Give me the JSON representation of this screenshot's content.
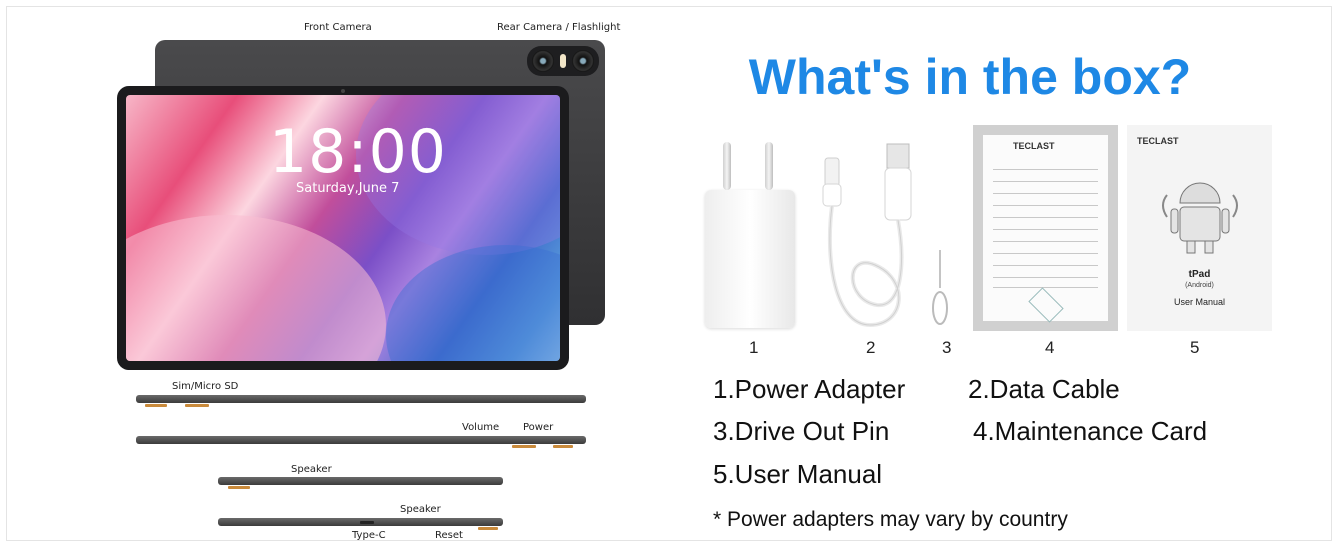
{
  "diagram_labels": {
    "front_camera": "Front Camera",
    "rear_camera": "Rear Camera / Flashlight",
    "sim_slot": "Sim/Micro SD",
    "volume": "Volume",
    "power": "Power",
    "speaker_top": "Speaker",
    "speaker_bottom": "Speaker",
    "type_c": "Type-C",
    "reset": "Reset"
  },
  "lockscreen": {
    "time": "18:00",
    "date": "Saturday,June 7"
  },
  "title": "What's in the box?",
  "item_numbers": [
    "1",
    "2",
    "3",
    "4",
    "5"
  ],
  "items": [
    "1.Power Adapter",
    "2.Data Cable",
    "3.Drive Out Pin",
    "4.Maintenance Card",
    "5.User Manual"
  ],
  "card_brand": "TECLAST",
  "manual": {
    "brand": "TECLAST",
    "product": "tPad",
    "os": "(Android)",
    "label": "User Manual"
  },
  "note": "* Power adapters may vary by country",
  "colors": {
    "title": "#1e88e5",
    "tablet_body": "#3a3a3c",
    "accent_button": "#c98a3b"
  }
}
